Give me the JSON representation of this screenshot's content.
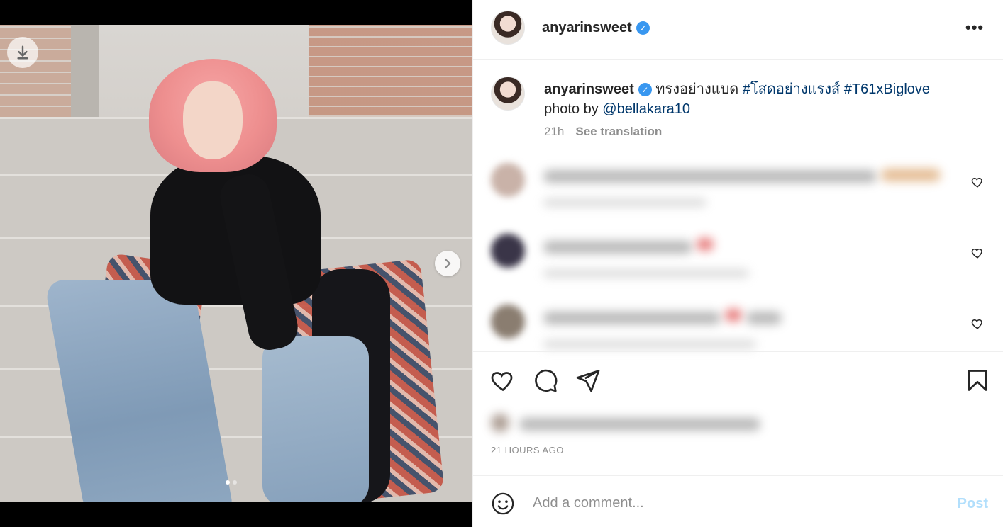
{
  "post": {
    "author": "anyarinsweet",
    "verified": true,
    "caption_text": "ทรงอย่างแบด",
    "hashtags": [
      "#โสดอย่างแรงส์",
      "#T61xBiglove"
    ],
    "photo_credit_prefix": "photo by",
    "photo_credit_handle": "@bellakara10",
    "age": "21h",
    "see_translation": "See translation",
    "time_ago": "21 HOURS AGO"
  },
  "header": {
    "more_label": "•••"
  },
  "media": {
    "slide_count": 2,
    "active_slide": 0
  },
  "comment_box": {
    "placeholder": "Add a comment...",
    "post_label": "Post"
  },
  "icons": {
    "verified": "verified-badge-icon",
    "more": "more-options-icon",
    "like": "heart-icon",
    "comment": "comment-icon",
    "share": "paper-plane-icon",
    "save": "bookmark-icon",
    "emoji": "emoji-icon",
    "download": "download-icon",
    "next": "chevron-right-icon"
  },
  "colors": {
    "link": "#00376b",
    "verified": "#3897f0",
    "post_disabled": "#b2dffc",
    "muted": "#8e8e8e"
  }
}
